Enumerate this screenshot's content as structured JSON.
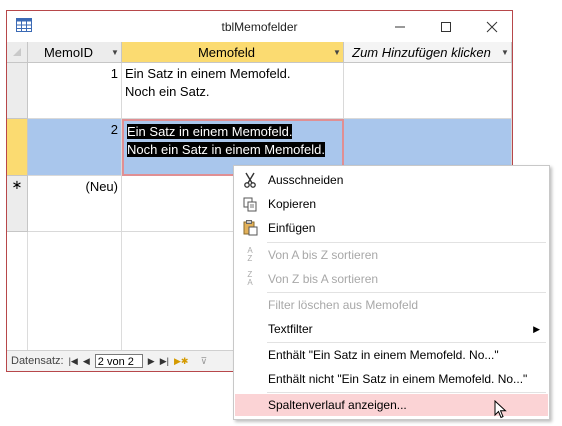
{
  "window": {
    "title": "tblMemofelder"
  },
  "grid": {
    "columns": [
      {
        "label": "MemoID",
        "has_dropdown": true
      },
      {
        "label": "Memofeld",
        "has_dropdown": true
      },
      {
        "label": "Zum Hinzufügen klicken",
        "has_dropdown": true
      }
    ],
    "rows": [
      {
        "id": "1",
        "memo_line1": "Ein Satz in einem Memofeld.",
        "memo_line2": "Noch ein Satz."
      },
      {
        "id": "2",
        "memo_line1": "Ein Satz in einem Memofeld.",
        "memo_line2": "Noch ein Satz in einem Memofeld."
      }
    ],
    "new_row_marker": "∗",
    "new_row_label": "(Neu)"
  },
  "statusbar": {
    "label": "Datensatz:",
    "record": "2 von 2"
  },
  "context_menu": {
    "items": [
      {
        "label": "Ausschneiden",
        "icon": "scissors-icon",
        "enabled": true
      },
      {
        "label": "Kopieren",
        "icon": "copy-icon",
        "enabled": true
      },
      {
        "label": "Einfügen",
        "icon": "paste-icon",
        "enabled": true
      },
      {
        "label": "Von A bis Z sortieren",
        "icon": "sort-az-icon",
        "enabled": false
      },
      {
        "label": "Von Z bis A sortieren",
        "icon": "sort-za-icon",
        "enabled": false
      },
      {
        "label": "Filter löschen aus Memofeld",
        "icon": "",
        "enabled": false
      },
      {
        "label": "Textfilter",
        "icon": "",
        "enabled": true,
        "submenu": true
      },
      {
        "label": "Enthält \"Ein Satz in einem Memofeld. No...\"",
        "icon": "",
        "enabled": true
      },
      {
        "label": "Enthält nicht \"Ein Satz in einem Memofeld. No...\"",
        "icon": "",
        "enabled": true
      },
      {
        "label": "Spaltenverlauf anzeigen...",
        "icon": "",
        "enabled": true,
        "highlighted": true
      }
    ]
  },
  "colors": {
    "window_border": "#b7474a",
    "selected_header": "#fbdb71",
    "row_selection": "#a9c6ec",
    "menu_highlight": "#fbd3d5"
  }
}
